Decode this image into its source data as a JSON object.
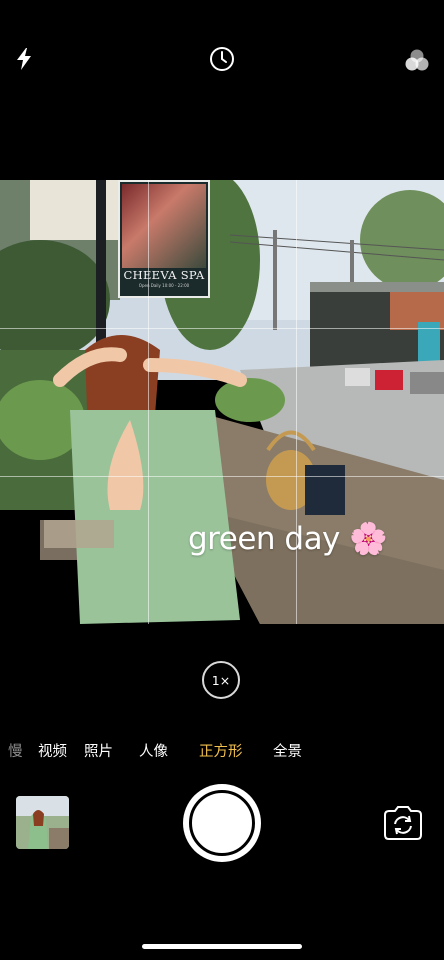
{
  "top_bar": {
    "flash_icon": "lightning-bolt-icon",
    "timer_icon": "live-photo-timer-icon",
    "filters_icon": "filters-circles-icon"
  },
  "viewfinder": {
    "sign_text": "CHEEVA SPA",
    "sign_subtext": "Open Daily 10:00 - 22:00",
    "caption_text": "green day",
    "caption_emoji": "🌸"
  },
  "zoom": {
    "label": "1×"
  },
  "modes": [
    {
      "label": "慢",
      "state": "dim"
    },
    {
      "label": "视频",
      "state": "normal"
    },
    {
      "label": "照片",
      "state": "normal"
    },
    {
      "label": "人像",
      "state": "normal"
    },
    {
      "label": "正方形",
      "state": "active"
    },
    {
      "label": "全景",
      "state": "normal"
    }
  ],
  "controls": {
    "thumbnail_icon": "last-photo-thumbnail",
    "shutter_icon": "shutter-button",
    "flip_icon": "camera-flip-icon"
  },
  "colors": {
    "active_mode": "#f2c14e",
    "background": "#000000"
  }
}
